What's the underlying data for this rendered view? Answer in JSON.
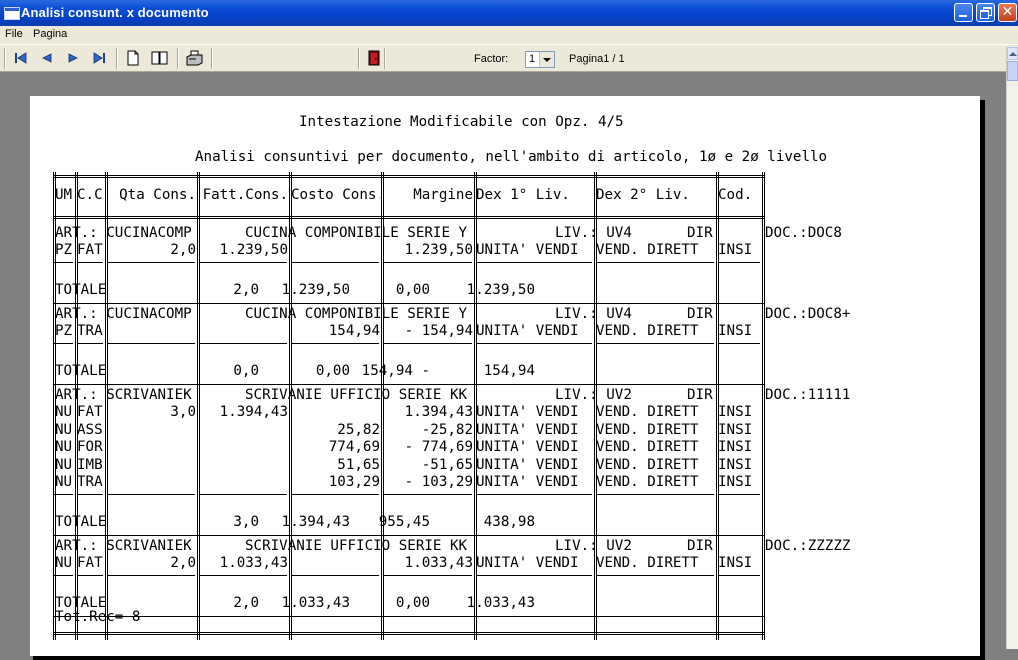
{
  "window": {
    "title": "Analisi consunt. x documento"
  },
  "menu": {
    "items": [
      "File",
      "Pagina"
    ]
  },
  "toolbar": {
    "factor_label": "Factor:",
    "factor_value": "1",
    "page_label": "Pagina1 / 1"
  },
  "report": {
    "title": "Intestazione Modificabile con Opz. 4/5",
    "subtitle": "Analisi consuntivi per documento, nell'ambito di articolo, 1ø e 2ø livello",
    "columns": [
      "UM",
      "C.C",
      "Qta Cons.",
      "Fatt.Cons.",
      "Costo Cons.",
      "Margine",
      "Dex 1° Liv.",
      "Dex 2° Liv.",
      "Cod."
    ],
    "groups": [
      {
        "header": [
          "ART.: CUCINACOMP",
          "CUCINA COMPONIBILE SERIE Y",
          "LIV.: UV4",
          "DIR",
          "DOC.:DOC8"
        ],
        "rows": [
          [
            "PZ",
            "FAT",
            "2,0",
            "1.239,50",
            "",
            "1.239,50",
            "UNITA' VENDI",
            "VEND. DIRETT",
            "INSI"
          ]
        ],
        "total": [
          "TOTALE",
          "2,0",
          "1.239,50",
          "0,00",
          "1.239,50"
        ]
      },
      {
        "header": [
          "ART.: CUCINACOMP",
          "CUCINA COMPONIBILE SERIE Y",
          "LIV.: UV4",
          "DIR",
          "DOC.:DOC8+"
        ],
        "rows": [
          [
            "PZ",
            "TRA",
            "",
            "",
            "154,94",
            "- 154,94",
            "UNITA' VENDI",
            "VEND. DIRETT",
            "INSI"
          ]
        ],
        "total": [
          "TOTALE",
          "0,0",
          "0,00",
          "154,94 -",
          "154,94"
        ]
      },
      {
        "header": [
          "ART.: SCRIVANIEK",
          "SCRIVANIE UFFICIO SERIE KK",
          "LIV.: UV2",
          "DIR",
          "DOC.:11111"
        ],
        "rows": [
          [
            "NU",
            "FAT",
            "3,0",
            "1.394,43",
            "",
            "1.394,43",
            "UNITA' VENDI",
            "VEND. DIRETT",
            "INSI"
          ],
          [
            "NU",
            "ASS",
            "",
            "",
            "25,82",
            "-25,82",
            "UNITA' VENDI",
            "VEND. DIRETT",
            "INSI"
          ],
          [
            "NU",
            "FOR",
            "",
            "",
            "774,69",
            "- 774,69",
            "UNITA' VENDI",
            "VEND. DIRETT",
            "INSI"
          ],
          [
            "NU",
            "IMB",
            "",
            "",
            "51,65",
            "-51,65",
            "UNITA' VENDI",
            "VEND. DIRETT",
            "INSI"
          ],
          [
            "NU",
            "TRA",
            "",
            "",
            "103,29",
            "- 103,29",
            "UNITA' VENDI",
            "VEND. DIRETT",
            "INSI"
          ]
        ],
        "total": [
          "TOTALE",
          "3,0",
          "1.394,43",
          "955,45",
          "438,98"
        ]
      },
      {
        "header": [
          "ART.: SCRIVANIEK",
          "SCRIVANIE UFFICIO SERIE KK",
          "LIV.: UV2",
          "DIR",
          "DOC.:ZZZZZ"
        ],
        "rows": [
          [
            "NU",
            "FAT",
            "2,0",
            "1.033,43",
            "",
            "1.033,43",
            "UNITA' VENDI",
            "VEND. DIRETT",
            "INSI"
          ]
        ],
        "total": [
          "TOTALE",
          "2,0",
          "1.033,43",
          "0,00",
          "1.033,43"
        ]
      }
    ],
    "footer": "Tot.Rec= 8"
  }
}
